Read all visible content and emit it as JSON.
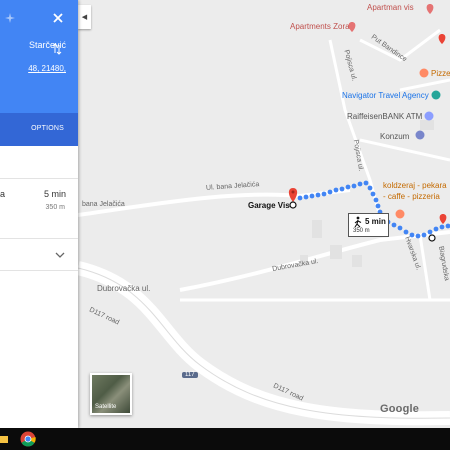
{
  "panel": {
    "origin_text": "Starčević",
    "destination_text": "48, 21480,",
    "options_label": "OPTIONS",
    "route": {
      "label_partial": "a",
      "time": "5 min",
      "distance": "350 m"
    }
  },
  "map": {
    "poi": {
      "apartman_vis": "Apartman vis",
      "apartments_zora": "Apartments Zora",
      "pizzeria": "Pizze",
      "navigator": "Navigator Travel Agency",
      "raiffeisen": "RaiffeisenBANK ATM",
      "konzum": "Konzum",
      "koldzeraj": "koldzeraj - pekara",
      "caffe_pizzeria": "- caffe - pizzeria",
      "garage": "Garage Vis"
    },
    "roads": {
      "put_bandince": "Put Bandince",
      "pojisca_top": "Pojisca ul.",
      "pojisca_mid": "Pojisca ul.",
      "bana_jelacica_left": "bana Jelačića",
      "bana_jelacica_mid": "Ul. bana Jelačića",
      "dubrovacka_mid": "Dubrovačka ul.",
      "dubrovacka_left": "Dubrovačka ul.",
      "hvarska": "Hvarska ul.",
      "biagrudska": "Biagrudska",
      "d117_left": "D117 road",
      "d117_right": "D117 road",
      "shield_117": "117"
    },
    "walk_time": "5 min",
    "walk_distance": "350 m",
    "satellite_label": "Satellite",
    "google_logo": "Google"
  },
  "colors": {
    "panel_header": "#4285f4",
    "panel_subheader": "#3367d6",
    "route_dots": "#4285f4",
    "pin": "#ea4335"
  }
}
